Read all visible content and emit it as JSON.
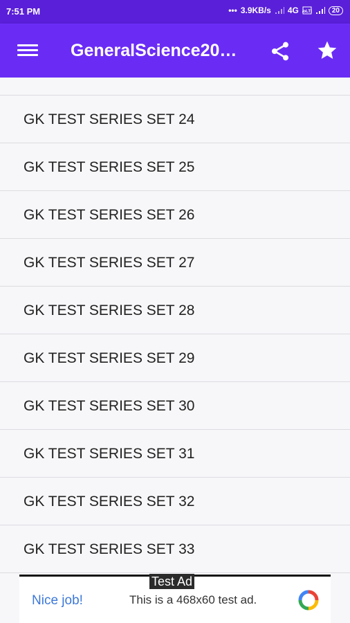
{
  "status_bar": {
    "time": "7:51 PM",
    "dots": "•••",
    "net_speed": "3.9KB/s",
    "network": "4G",
    "volte": "VoLTE",
    "battery": "20"
  },
  "app_bar": {
    "title": "GeneralScience20…",
    "menu_icon": "hamburger-menu-icon",
    "share_icon": "share-icon",
    "star_icon": "star-icon"
  },
  "list": {
    "items": [
      "GK TEST SERIES SET 24",
      "GK TEST SERIES SET 25",
      "GK TEST SERIES SET 26",
      "GK TEST SERIES SET 27",
      "GK TEST SERIES SET 28",
      "GK TEST SERIES SET 29",
      "GK TEST SERIES SET 30",
      "GK TEST SERIES SET 31",
      "GK TEST SERIES SET 32",
      "GK TEST SERIES SET 33"
    ]
  },
  "ad": {
    "badge": "Test Ad",
    "nice": "Nice job!",
    "text": "This is a 468x60 test ad.",
    "logo_icon": "ad-logo-icon"
  },
  "colors": {
    "status_bar": "#5a1fd8",
    "app_bar": "#6a2cf5",
    "list_bg": "#f7f7f9",
    "accent_blue": "#3c78d8"
  }
}
